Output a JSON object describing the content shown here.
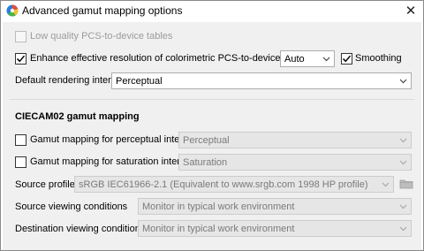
{
  "window": {
    "title": "Advanced gamut mapping options",
    "close_glyph": "✕",
    "app_icon": "color-wheel-icon"
  },
  "low_quality": {
    "label": "Low quality PCS-to-device tables",
    "checked": false,
    "enabled": false
  },
  "enhance": {
    "label": "Enhance effective resolution of colorimetric PCS-to-device table",
    "checked": true,
    "mode_value": "Auto",
    "smoothing_label": "Smoothing",
    "smoothing_checked": true
  },
  "default_intent": {
    "label": "Default rendering intent",
    "value": "Perceptual"
  },
  "ciecam": {
    "heading": "CIECAM02 gamut mapping",
    "perceptual": {
      "label": "Gamut mapping for perceptual intent",
      "checked": false,
      "value": "Perceptual"
    },
    "saturation": {
      "label": "Gamut mapping for saturation intent",
      "checked": false,
      "value": "Saturation"
    },
    "source_profile": {
      "label": "Source profile",
      "value": "sRGB IEC61966-2.1 (Equivalent to www.srgb.com 1998 HP profile)"
    },
    "source_viewing": {
      "label": "Source viewing conditions",
      "value": "Monitor in typical work environment"
    },
    "dest_viewing": {
      "label": "Destination viewing conditions",
      "value": "Monitor in typical work environment"
    }
  },
  "colors": {
    "dialog_bg": "#f0f0f0",
    "disabled_text": "#9c9c9c",
    "disabled_field": "#e6e6e6"
  }
}
